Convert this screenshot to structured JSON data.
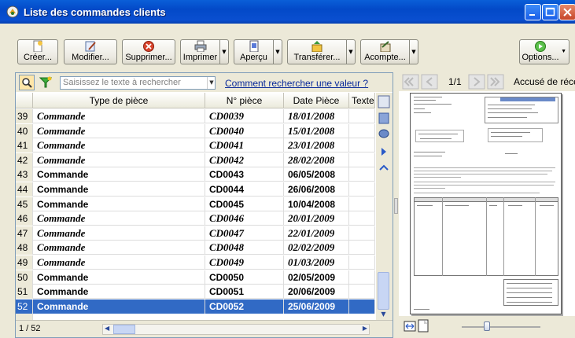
{
  "window": {
    "title": "Liste des commandes clients"
  },
  "toolbar": {
    "create": "Créer...",
    "modify": "Modifier...",
    "delete": "Supprimer...",
    "print": "Imprimer",
    "preview": "Aperçu",
    "transfer": "Transférer...",
    "deposit": "Acompte...",
    "options": "Options..."
  },
  "search": {
    "placeholder": "Saisissez le texte à rechercher",
    "help_link": "Comment rechercher une valeur ?"
  },
  "table": {
    "headers": {
      "type": "Type de pièce",
      "piece": "N° pièce",
      "date": "Date Pièce",
      "text": "Texte lib"
    },
    "rows": [
      {
        "n": "39",
        "type": "Commande",
        "piece": "CD0039",
        "date": "18/01/2008",
        "style": "it"
      },
      {
        "n": "40",
        "type": "Commande",
        "piece": "CD0040",
        "date": "15/01/2008",
        "style": "it"
      },
      {
        "n": "41",
        "type": "Commande",
        "piece": "CD0041",
        "date": "23/01/2008",
        "style": "it"
      },
      {
        "n": "42",
        "type": "Commande",
        "piece": "CD0042",
        "date": "28/02/2008",
        "style": "it"
      },
      {
        "n": "43",
        "type": "Commande",
        "piece": "CD0043",
        "date": "06/05/2008",
        "style": "bd"
      },
      {
        "n": "44",
        "type": "Commande",
        "piece": "CD0044",
        "date": "26/06/2008",
        "style": "bd"
      },
      {
        "n": "45",
        "type": "Commande",
        "piece": "CD0045",
        "date": "10/04/2008",
        "style": "bd"
      },
      {
        "n": "46",
        "type": "Commande",
        "piece": "CD0046",
        "date": "20/01/2009",
        "style": "it"
      },
      {
        "n": "47",
        "type": "Commande",
        "piece": "CD0047",
        "date": "22/01/2009",
        "style": "it"
      },
      {
        "n": "48",
        "type": "Commande",
        "piece": "CD0048",
        "date": "02/02/2009",
        "style": "it"
      },
      {
        "n": "49",
        "type": "Commande",
        "piece": "CD0049",
        "date": "01/03/2009",
        "style": "it"
      },
      {
        "n": "50",
        "type": "Commande",
        "piece": "CD0050",
        "date": "02/05/2009",
        "style": "bd"
      },
      {
        "n": "51",
        "type": "Commande",
        "piece": "CD0051",
        "date": "20/06/2009",
        "style": "bd"
      },
      {
        "n": "52",
        "type": "Commande",
        "piece": "CD0052",
        "date": "25/06/2009",
        "style": "bd sel"
      }
    ]
  },
  "footer": {
    "position": "1 / 52"
  },
  "preview": {
    "page": "1/1",
    "title": "Accusé de réce"
  },
  "colors": {
    "titlebar": "#0349c8",
    "selection": "#316ac5",
    "link": "#0a2a9a"
  }
}
